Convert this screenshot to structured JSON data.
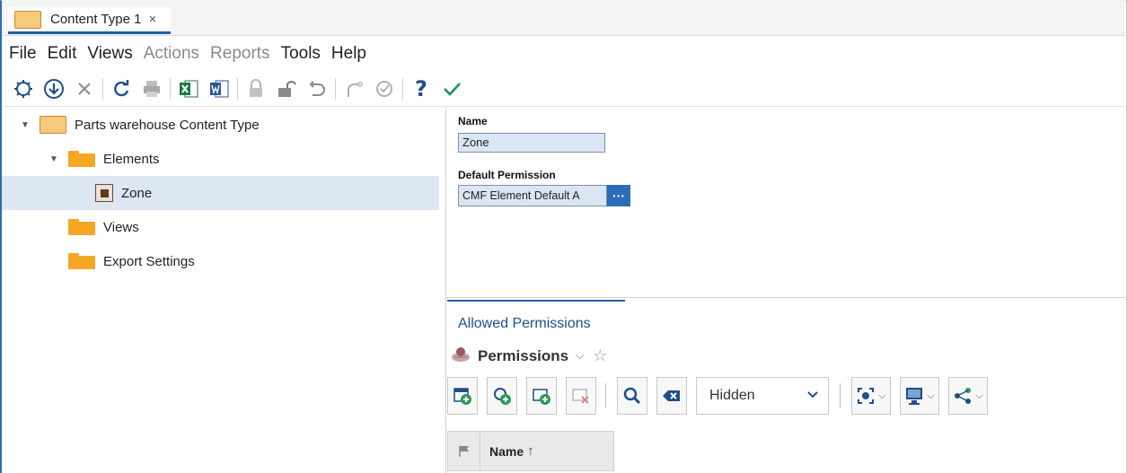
{
  "tab": {
    "title": "Content Type 1",
    "close": "×"
  },
  "menu": [
    {
      "label": "File",
      "enabled": true
    },
    {
      "label": "Edit",
      "enabled": true
    },
    {
      "label": "Views",
      "enabled": true
    },
    {
      "label": "Actions",
      "enabled": false
    },
    {
      "label": "Reports",
      "enabled": false
    },
    {
      "label": "Tools",
      "enabled": true
    },
    {
      "label": "Help",
      "enabled": true
    }
  ],
  "toolbar": {
    "help_glyph": "?"
  },
  "tree": {
    "root": "Parts warehouse Content Type",
    "elements": "Elements",
    "zone": "Zone",
    "views": "Views",
    "export": "Export Settings"
  },
  "properties": {
    "name_label": "Name",
    "name_value": "Zone",
    "perm_label": "Default Permission",
    "perm_value": "CMF Element Default A",
    "perm_button": "···"
  },
  "allowed": {
    "title": "Allowed Permissions",
    "grid_title": "Permissions",
    "dropdown_value": "Hidden",
    "column_name": "Name",
    "sort_arrow": "↑"
  },
  "colors": {
    "accent": "#2b6cb8",
    "folder": "#f5a623",
    "selected": "#dde6f3"
  }
}
